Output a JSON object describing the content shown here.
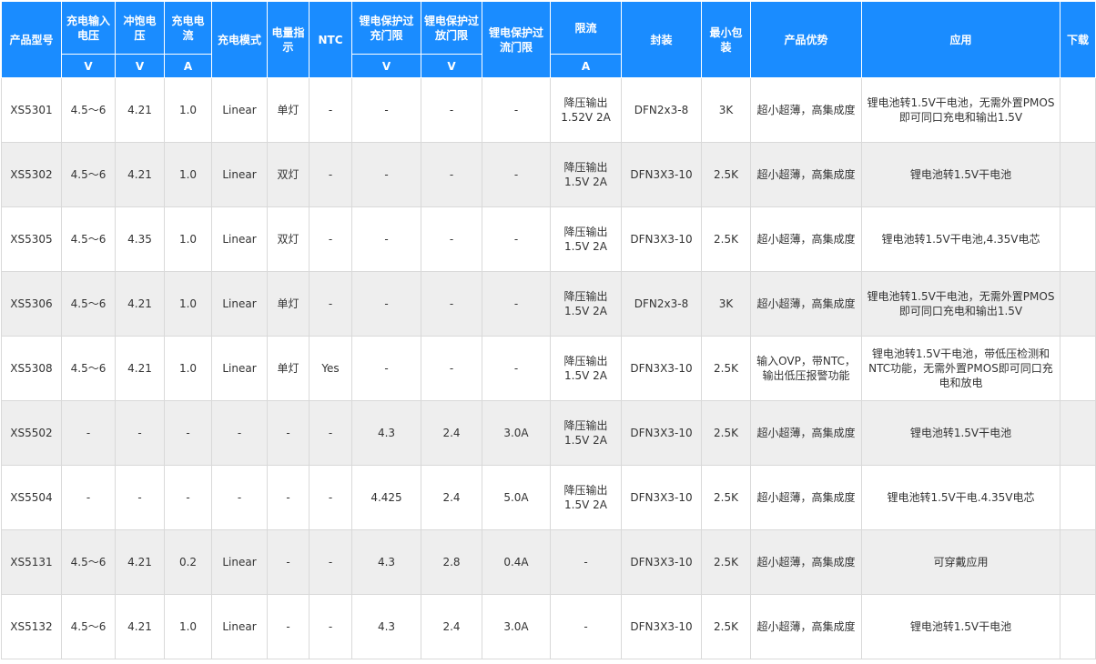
{
  "header": {
    "model": "产品型号",
    "input_voltage": "充电输入电压",
    "sat_voltage": "冲饱电压",
    "charge_current": "充电电流",
    "charge_mode": "充电模式",
    "indicator": "电量指示",
    "ntc": "NTC",
    "overcharge": "锂电保护过充门限",
    "overdischarge": "锂电保护过放门限",
    "overcurrent": "锂电保护过流门限",
    "current_limit": "限流",
    "package": "封装",
    "min_pack": "最小包装",
    "advantage": "产品优势",
    "application": "应用",
    "download": "下载"
  },
  "units": {
    "input_voltage": "V",
    "sat_voltage": "V",
    "charge_current": "A",
    "overcharge": "V",
    "overdischarge": "V",
    "current_limit": "A"
  },
  "rows": [
    [
      "XS5301",
      "4.5～6",
      "4.21",
      "1.0",
      "Linear",
      "单灯",
      "-",
      "-",
      "-",
      "-",
      "降压输出1.52V 2A",
      "DFN2x3-8",
      "3K",
      "超小超薄，高集成度",
      "锂电池转1.5V干电池，无需外置PMOS即可同口充电和输出1.5V",
      ""
    ],
    [
      "XS5302",
      "4.5～6",
      "4.21",
      "1.0",
      "Linear",
      "双灯",
      "-",
      "-",
      "-",
      "-",
      "降压输出1.5V 2A",
      "DFN3X3-10",
      "2.5K",
      "超小超薄，高集成度",
      "锂电池转1.5V干电池",
      ""
    ],
    [
      "XS5305",
      "4.5～6",
      "4.35",
      "1.0",
      "Linear",
      "双灯",
      "-",
      "-",
      "-",
      "-",
      "降压输出1.5V 2A",
      "DFN3X3-10",
      "2.5K",
      "超小超薄，高集成度",
      "锂电池转1.5V干电池,4.35V电芯",
      ""
    ],
    [
      "XS5306",
      "4.5～6",
      "4.21",
      "1.0",
      "Linear",
      "单灯",
      "-",
      "-",
      "-",
      "-",
      "降压输出1.5V 2A",
      "DFN2x3-8",
      "3K",
      "超小超薄，高集成度",
      "锂电池转1.5V干电池，无需外置PMOS即可同口充电和输出1.5V",
      ""
    ],
    [
      "XS5308",
      "4.5～6",
      "4.21",
      "1.0",
      "Linear",
      "单灯",
      "Yes",
      "-",
      "-",
      "-",
      "降压输出1.5V 2A",
      "DFN3X3-10",
      "2.5K",
      "输入OVP，带NTC，输出低压报警功能",
      "锂电池转1.5V干电池，带低压检测和NTC功能，无需外置PMOS即可同口充电和放电",
      ""
    ],
    [
      "XS5502",
      "-",
      "-",
      "-",
      "-",
      "-",
      "-",
      "4.3",
      "2.4",
      "3.0A",
      "降压输出1.5V 2A",
      "DFN3X3-10",
      "2.5K",
      "超小超薄，高集成度",
      "锂电池转1.5V干电池",
      ""
    ],
    [
      "XS5504",
      "-",
      "-",
      "-",
      "-",
      "-",
      "-",
      "4.425",
      "2.4",
      "5.0A",
      "降压输出1.5V 2A",
      "DFN3X3-10",
      "2.5K",
      "超小超薄，高集成度",
      "锂电池转1.5V干电.4.35V电芯",
      ""
    ],
    [
      "XS5131",
      "4.5～6",
      "4.21",
      "0.2",
      "Linear",
      "-",
      "-",
      "4.3",
      "2.8",
      "0.4A",
      "-",
      "DFN3X3-10",
      "2.5K",
      "超小超薄，高集成度",
      "可穿戴应用",
      ""
    ],
    [
      "XS5132",
      "4.5～6",
      "4.21",
      "1.0",
      "Linear",
      "-",
      "-",
      "4.3",
      "2.4",
      "3.0A",
      "-",
      "DFN3X3-10",
      "2.5K",
      "超小超薄，高集成度",
      "锂电池转1.5V干电池",
      ""
    ]
  ]
}
